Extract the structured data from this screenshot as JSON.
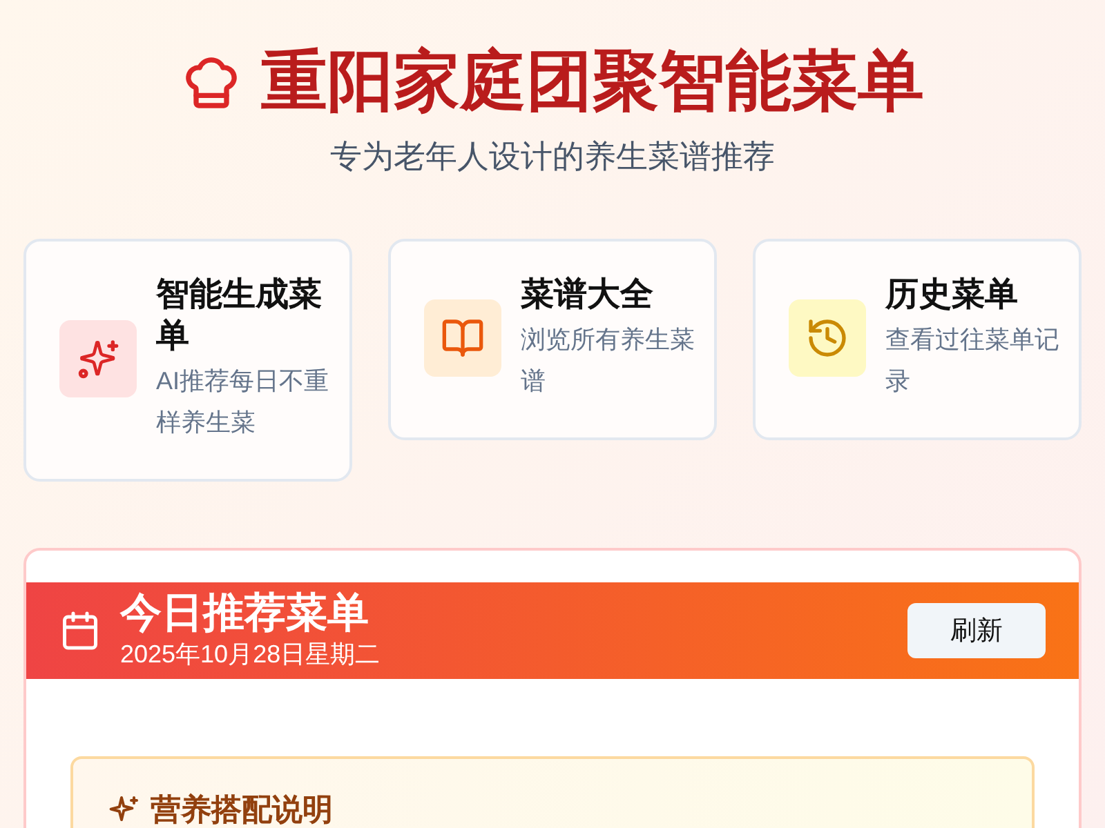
{
  "header": {
    "title": "重阳家庭团聚智能菜单",
    "subtitle": "专为老年人设计的养生菜谱推荐"
  },
  "features": [
    {
      "kind": "sparkle",
      "title": "智能生成菜单",
      "description": "AI推荐每日不重样养生菜"
    },
    {
      "kind": "book",
      "title": "菜谱大全",
      "description": "浏览所有养生菜谱"
    },
    {
      "kind": "history",
      "title": "历史菜单",
      "description": "查看过往菜单记录"
    }
  ],
  "today": {
    "title": "今日推荐菜单",
    "date": "2025年10月28日星期二",
    "refresh_button": "刷新",
    "nutrition": {
      "title": "营养搭配说明"
    }
  }
}
